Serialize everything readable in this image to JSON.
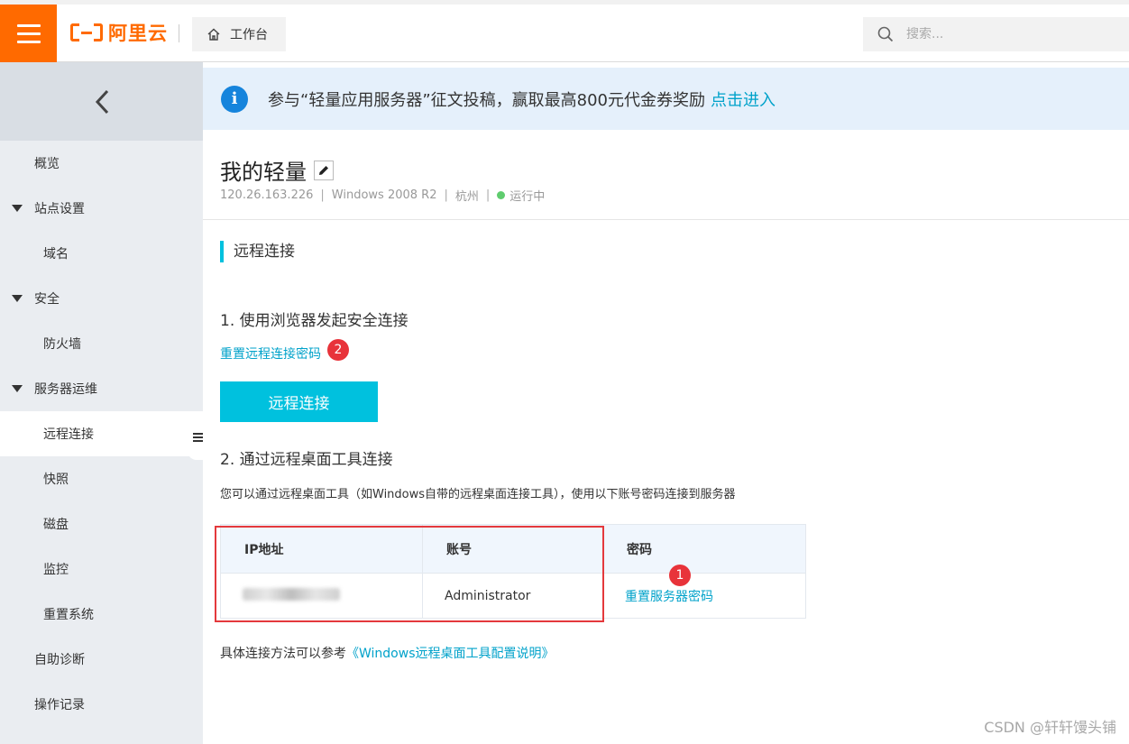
{
  "header": {
    "brand": "阿里云",
    "workbench_label": "工作台",
    "search_placeholder": "搜索..."
  },
  "sidebar": {
    "items": [
      {
        "label": "概览",
        "level": 1
      },
      {
        "label": "站点设置",
        "level": 1,
        "expanded": true
      },
      {
        "label": "域名",
        "level": 2
      },
      {
        "label": "安全",
        "level": 1,
        "expanded": true
      },
      {
        "label": "防火墙",
        "level": 2
      },
      {
        "label": "服务器运维",
        "level": 1,
        "expanded": true
      },
      {
        "label": "远程连接",
        "level": 2,
        "active": true
      },
      {
        "label": "快照",
        "level": 2
      },
      {
        "label": "磁盘",
        "level": 2
      },
      {
        "label": "监控",
        "level": 2
      },
      {
        "label": "重置系统",
        "level": 2
      },
      {
        "label": "自助诊断",
        "level": 1
      },
      {
        "label": "操作记录",
        "level": 1
      }
    ]
  },
  "notice": {
    "text": "参与“轻量应用服务器”征文投稿，赢取最高800元代金券奖励",
    "link": "点击进入"
  },
  "server": {
    "title": "我的轻量",
    "ip": "120.26.163.226",
    "os": "Windows 2008 R2",
    "region": "杭州",
    "status": "运行中"
  },
  "remote": {
    "section_title": "远程连接",
    "step1": "1. 使用浏览器发起安全连接",
    "reset_link": "重置远程连接密码",
    "connect_button": "远程连接",
    "step2": "2. 通过远程桌面工具连接",
    "description": "您可以通过远程桌面工具（如Windows自带的远程桌面连接工具），使用以下账号密码连接到服务器",
    "table": {
      "headers": [
        "IP地址",
        "账号",
        "密码"
      ],
      "account": "Administrator",
      "password_link": "重置服务器密码"
    },
    "footer_text": "具体连接方法可以参考",
    "footer_link": "《Windows远程桌面工具配置说明》"
  },
  "annotations": {
    "badge1": "1",
    "badge2": "2"
  },
  "watermark": "CSDN @轩轩馒头铺",
  "colors": {
    "brand": "#ff6a00",
    "accent": "#00c1de",
    "link": "#00a2ca",
    "badge": "#e8333a",
    "status_ok": "#5fcc6e"
  }
}
